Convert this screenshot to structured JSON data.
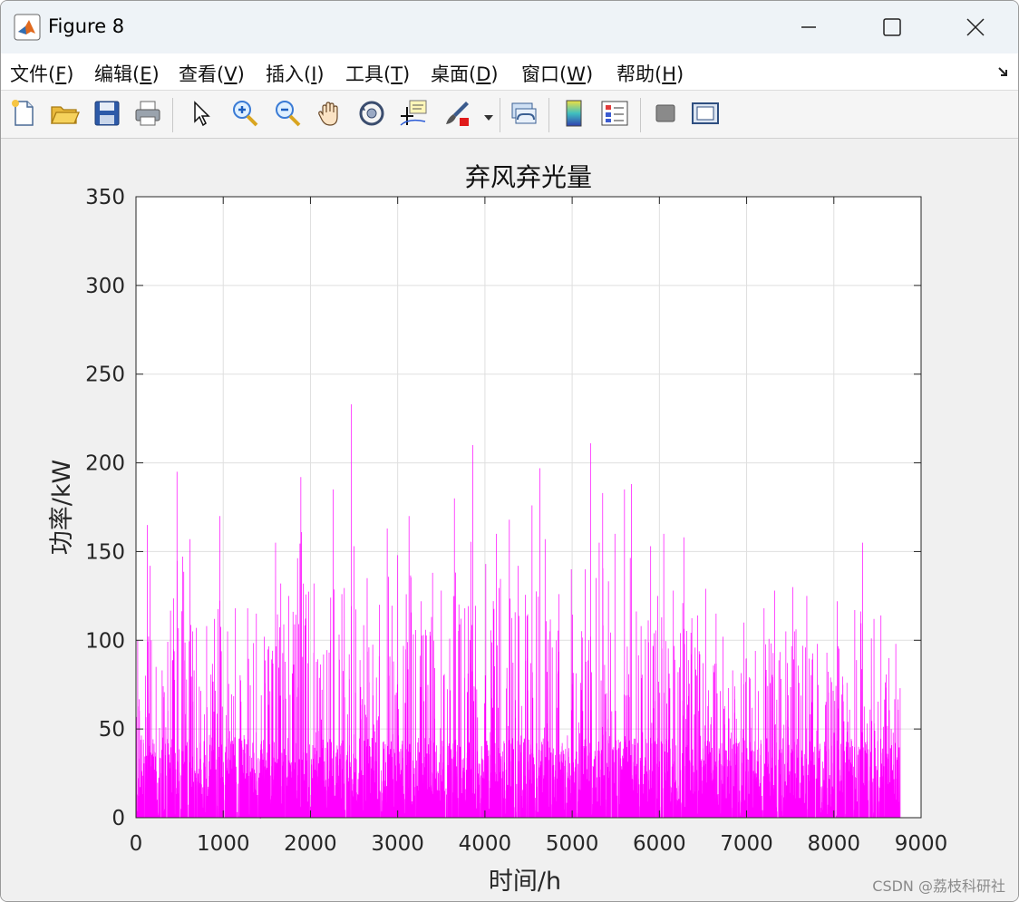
{
  "window": {
    "title": "Figure 8",
    "controls": [
      "minimize",
      "maximize",
      "close"
    ]
  },
  "menu": [
    {
      "label": "文件(",
      "key": "F",
      "end": ")"
    },
    {
      "label": "编辑(",
      "key": "E",
      "end": ")"
    },
    {
      "label": "查看(",
      "key": "V",
      "end": ")"
    },
    {
      "label": "插入(",
      "key": "I",
      "end": ")"
    },
    {
      "label": "工具(",
      "key": "T",
      "end": ")"
    },
    {
      "label": "桌面(",
      "key": "D",
      "end": ")"
    },
    {
      "label": "窗口(",
      "key": "W",
      "end": ")"
    },
    {
      "label": "帮助(",
      "key": "H",
      "end": ")"
    }
  ],
  "menu_dock_icon": "dock-arrow-icon",
  "toolbar": [
    "new-figure-icon",
    "open-file-icon",
    "save-icon",
    "print-icon",
    "pointer-icon",
    "zoom-in-icon",
    "zoom-out-icon",
    "pan-icon",
    "rotate-3d-icon",
    "data-cursor-icon",
    "brush-icon",
    "link-plot-icon",
    "colorbar-icon",
    "legend-icon",
    "hide-plot-tools-icon",
    "show-plot-tools-icon"
  ],
  "colors": {
    "series": "#ff00ff",
    "axes_bg": "#ffffff",
    "figure_bg": "#f0f0f0",
    "grid": "#dfdfdf"
  },
  "chart_data": {
    "type": "line",
    "title": "弃风弃光量",
    "xlabel": "时间/h",
    "ylabel": "功率/kW",
    "xlim": [
      0,
      9000
    ],
    "ylim": [
      0,
      350
    ],
    "xticks": [
      0,
      1000,
      2000,
      3000,
      4000,
      5000,
      6000,
      7000,
      8000,
      9000
    ],
    "yticks": [
      0,
      50,
      100,
      150,
      200,
      250,
      300,
      350
    ],
    "grid": true,
    "series": [
      {
        "color": "#ff00ff",
        "x_start": 0,
        "x_end": 8760,
        "peaks": [
          [
            20,
            100
          ],
          [
            110,
            80
          ],
          [
            130,
            165
          ],
          [
            160,
            142
          ],
          [
            230,
            85
          ],
          [
            300,
            83
          ],
          [
            470,
            195
          ],
          [
            620,
            157
          ],
          [
            650,
            105
          ],
          [
            690,
            107
          ],
          [
            810,
            108
          ],
          [
            900,
            112
          ],
          [
            960,
            170
          ],
          [
            1050,
            105
          ],
          [
            1140,
            118
          ],
          [
            1280,
            118
          ],
          [
            1380,
            115
          ],
          [
            1470,
            102
          ],
          [
            1600,
            155
          ],
          [
            1660,
            132
          ],
          [
            1750,
            125
          ],
          [
            1890,
            192
          ],
          [
            2040,
            132
          ],
          [
            2150,
            92
          ],
          [
            2260,
            185
          ],
          [
            2360,
            126
          ],
          [
            2470,
            233
          ],
          [
            2500,
            153
          ],
          [
            2650,
            135
          ],
          [
            2790,
            120
          ],
          [
            2880,
            163
          ],
          [
            3000,
            148
          ],
          [
            3130,
            170
          ],
          [
            3270,
            122
          ],
          [
            3400,
            138
          ],
          [
            3500,
            128
          ],
          [
            3650,
            180
          ],
          [
            3770,
            118
          ],
          [
            3860,
            210
          ],
          [
            4010,
            143
          ],
          [
            4130,
            160
          ],
          [
            4280,
            168
          ],
          [
            4380,
            142
          ],
          [
            4540,
            176
          ],
          [
            4630,
            197
          ],
          [
            4690,
            157
          ],
          [
            4850,
            126
          ],
          [
            4990,
            140
          ],
          [
            5150,
            140
          ],
          [
            5210,
            211
          ],
          [
            5310,
            155
          ],
          [
            5350,
            183
          ],
          [
            5490,
            160
          ],
          [
            5600,
            185
          ],
          [
            5680,
            188
          ],
          [
            5790,
            108
          ],
          [
            5900,
            153
          ],
          [
            5980,
            125
          ],
          [
            6050,
            160
          ],
          [
            6160,
            128
          ],
          [
            6280,
            158
          ],
          [
            6440,
            114
          ],
          [
            6530,
            129
          ],
          [
            6650,
            115
          ],
          [
            6730,
            102
          ],
          [
            6840,
            83
          ],
          [
            6970,
            110
          ],
          [
            7100,
            94
          ],
          [
            7200,
            118
          ],
          [
            7320,
            128
          ],
          [
            7450,
            105
          ],
          [
            7530,
            130
          ],
          [
            7690,
            125
          ],
          [
            7810,
            98
          ],
          [
            7920,
            93
          ],
          [
            8040,
            122
          ],
          [
            8150,
            76
          ],
          [
            8240,
            117
          ],
          [
            8330,
            155
          ],
          [
            8460,
            112
          ],
          [
            8540,
            114
          ],
          [
            8630,
            90
          ],
          [
            8710,
            98
          ],
          [
            8760,
            73
          ]
        ]
      }
    ]
  },
  "watermark": "CSDN @荔枝科研社"
}
